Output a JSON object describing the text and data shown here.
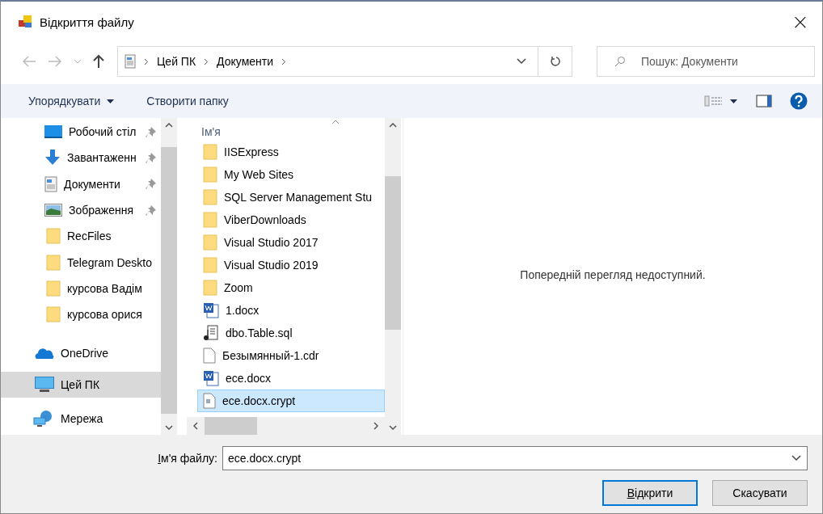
{
  "window": {
    "title": "Відкриття файлу",
    "close": "×"
  },
  "address": {
    "crumbs": [
      "Цей ПК",
      "Документи"
    ]
  },
  "search": {
    "placeholder": "Пошук: Документи"
  },
  "toolbar": {
    "organize": "Упорядкувати",
    "new_folder": "Створити папку"
  },
  "nav": [
    {
      "kind": "desktop",
      "label": "Робочий стіл",
      "pinned": true,
      "selected": false
    },
    {
      "kind": "download",
      "label": "Завантаженн",
      "pinned": true,
      "selected": false
    },
    {
      "kind": "documents",
      "label": "Документи",
      "pinned": true,
      "selected": false
    },
    {
      "kind": "pictures",
      "label": "Зображення",
      "pinned": true,
      "selected": false
    },
    {
      "kind": "folder",
      "label": "RecFiles",
      "pinned": false,
      "selected": false
    },
    {
      "kind": "folder",
      "label": "Telegram Deskto",
      "pinned": false,
      "selected": false
    },
    {
      "kind": "folder",
      "label": "курсова Вадім",
      "pinned": false,
      "selected": false
    },
    {
      "kind": "folder",
      "label": "курсова орися",
      "pinned": false,
      "selected": false
    },
    {
      "kind": "cloud",
      "label": "OneDrive",
      "pinned": false,
      "selected": false
    },
    {
      "kind": "computer",
      "label": "Цей ПК",
      "pinned": false,
      "selected": true
    },
    {
      "kind": "network",
      "label": "Мережа",
      "pinned": false,
      "selected": false
    }
  ],
  "files": {
    "column": "Ім'я",
    "items": [
      {
        "kind": "folder",
        "name": "IISExpress",
        "selected": false
      },
      {
        "kind": "folder",
        "name": "My Web Sites",
        "selected": false
      },
      {
        "kind": "folder",
        "name": "SQL Server Management Stu",
        "selected": false
      },
      {
        "kind": "folder",
        "name": "ViberDownloads",
        "selected": false
      },
      {
        "kind": "folder",
        "name": "Visual Studio 2017",
        "selected": false
      },
      {
        "kind": "folder",
        "name": "Visual Studio 2019",
        "selected": false
      },
      {
        "kind": "folder",
        "name": "Zoom",
        "selected": false
      },
      {
        "kind": "word",
        "name": "1.docx",
        "selected": false
      },
      {
        "kind": "sql",
        "name": "dbo.Table.sql",
        "selected": false
      },
      {
        "kind": "blank",
        "name": "Безымянный-1.cdr",
        "selected": false
      },
      {
        "kind": "word",
        "name": "ece.docx",
        "selected": false
      },
      {
        "kind": "crypt",
        "name": "ece.docx.crypt",
        "selected": true
      }
    ]
  },
  "preview": {
    "message": "Попередній перегляд недоступний."
  },
  "footer": {
    "filename_label": "Ім'я файлу:",
    "filename": "ece.docx.crypt",
    "open": "Відкрити",
    "cancel": "Скасувати"
  }
}
